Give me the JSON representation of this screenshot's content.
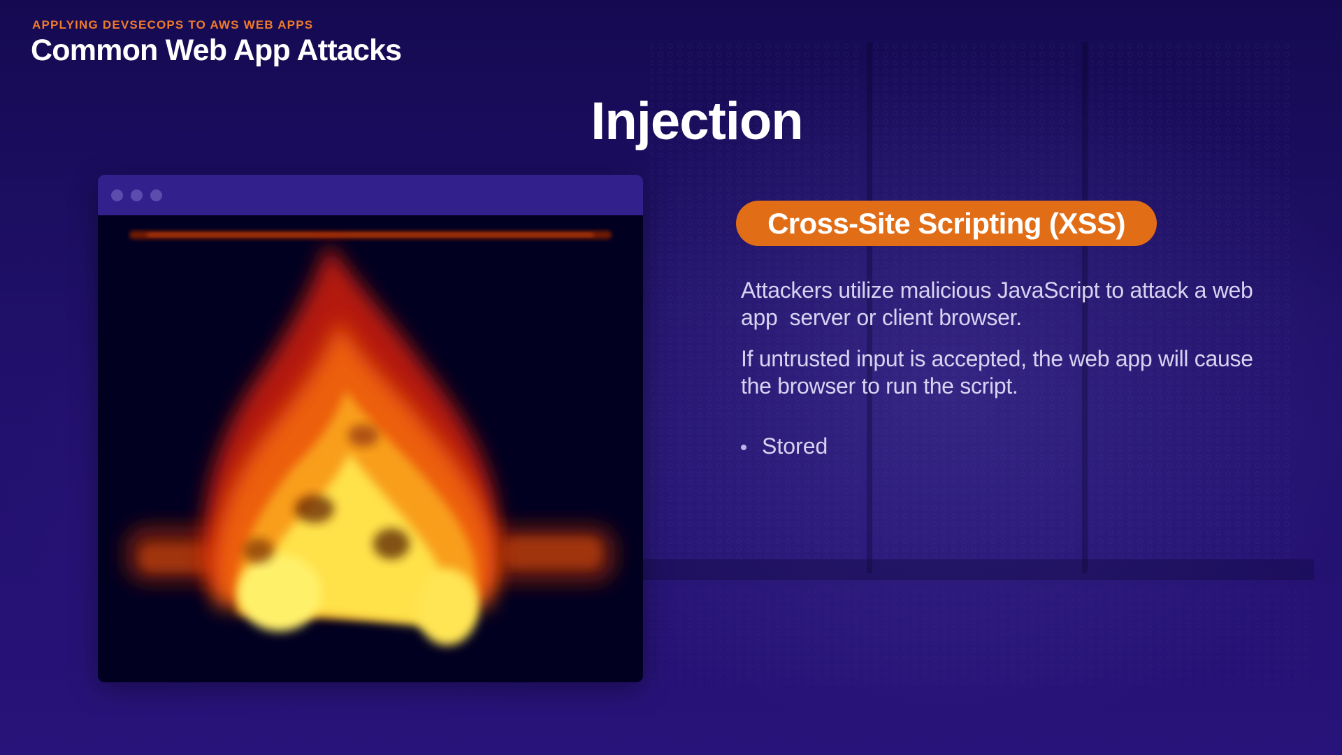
{
  "header": {
    "kicker": "APPLYING DEVSECOPS TO AWS WEB APPS",
    "deck_title": "Common Web App Attacks"
  },
  "slide": {
    "title": "Injection"
  },
  "browser_mock": {
    "dots": [
      "window-dot",
      "window-dot",
      "window-dot"
    ],
    "content_icon": "fire-animation"
  },
  "topic": {
    "label": "Cross-Site Scripting (XSS)",
    "paragraphs": [
      "Attackers utilize malicious JavaScript to attack a web app  server or client browser.",
      "If untrusted input is accepted, the web app will cause the browser to run the script."
    ],
    "bullets": [
      "Stored"
    ]
  },
  "colors": {
    "accent_orange": "#e26d17",
    "kicker_orange": "#f07c2a",
    "background_purple": "#20106a",
    "body_text": "#d9d3f2"
  }
}
